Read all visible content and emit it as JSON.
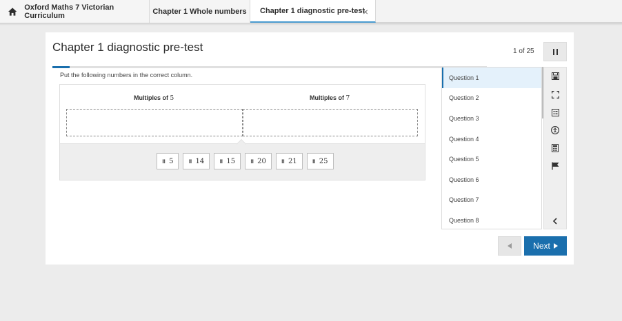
{
  "tabs": {
    "home_label": "Oxford Maths 7 Victorian Curriculum",
    "chapter_label": "Chapter 1 Whole numbers",
    "active_label": "Chapter 1 diagnostic pre-test",
    "close_glyph": "×"
  },
  "page": {
    "title": "Chapter 1 diagnostic pre-test",
    "counter": "1 of 25",
    "progress_fraction": 0.04
  },
  "question": {
    "instruction": "Put the following numbers in the correct column.",
    "columns": [
      {
        "label": "Multiples of ",
        "num": "5"
      },
      {
        "label": "Multiples of ",
        "num": "7"
      }
    ],
    "chips": [
      "5",
      "14",
      "15",
      "20",
      "21",
      "25"
    ]
  },
  "question_list": [
    "Question 1",
    "Question 2",
    "Question 3",
    "Question 4",
    "Question 5",
    "Question 6",
    "Question 7",
    "Question 8"
  ],
  "toolbar_icons": [
    "save-icon",
    "fullscreen-icon",
    "review-list-icon",
    "accessibility-icon",
    "calculator-icon",
    "flag-icon",
    "chevron-left-icon"
  ],
  "nav": {
    "next_label": "Next"
  },
  "colors": {
    "accent": "#1a6fad",
    "active_tab_underline": "#4a9bd0"
  }
}
